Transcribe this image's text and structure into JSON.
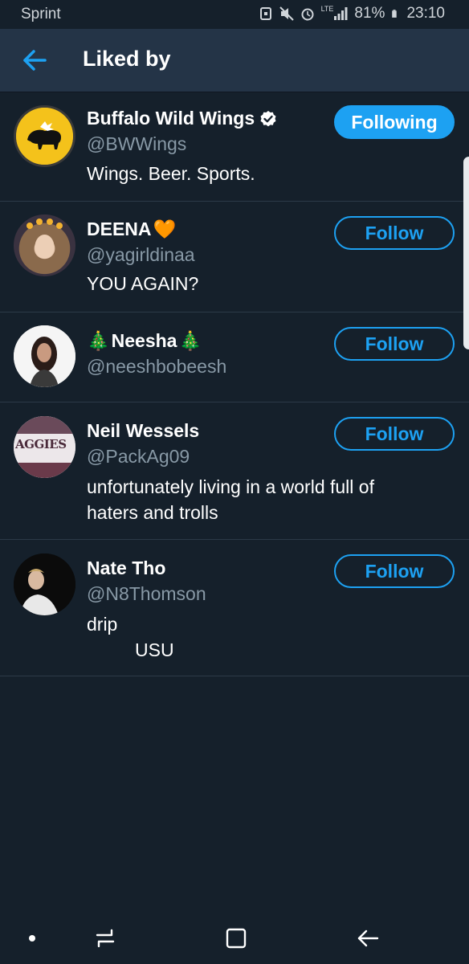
{
  "status_bar": {
    "carrier": "Sprint",
    "network": "LTE",
    "battery": "81%",
    "time": "23:10"
  },
  "header": {
    "title": "Liked by",
    "back_icon": "back-arrow-icon"
  },
  "colors": {
    "background": "#15202b",
    "header": "#243447",
    "accent": "#1da1f2",
    "secondary_text": "#8899a6"
  },
  "users": [
    {
      "name": "Buffalo Wild Wings",
      "verified": true,
      "handle": "@BWWings",
      "bio": "Wings. Beer. Sports.",
      "button": "Following"
    },
    {
      "name": "DEENA",
      "name_emoji": "🧡",
      "handle": "@yagirldinaa",
      "bio": "YOU AGAIN?",
      "button": "Follow"
    },
    {
      "name_prefix": "🎄",
      "name": "Neesha",
      "name_suffix": "🎄",
      "handle": "@neeshbobeesh",
      "button": "Follow"
    },
    {
      "name": "Neil Wessels",
      "handle": "@PackAg09",
      "bio": "unfortunately living in a world full of haters and trolls",
      "button": "Follow",
      "avatar_text": "AGGIES"
    },
    {
      "name": "Nate Tho",
      "handle": "@N8Thomson",
      "bio_line1": "drip",
      "bio_line2": "USU",
      "button": "Follow"
    }
  ],
  "nav_bar": {
    "icons": [
      "dot-icon",
      "recent-apps-icon",
      "home-icon",
      "back-icon"
    ]
  }
}
